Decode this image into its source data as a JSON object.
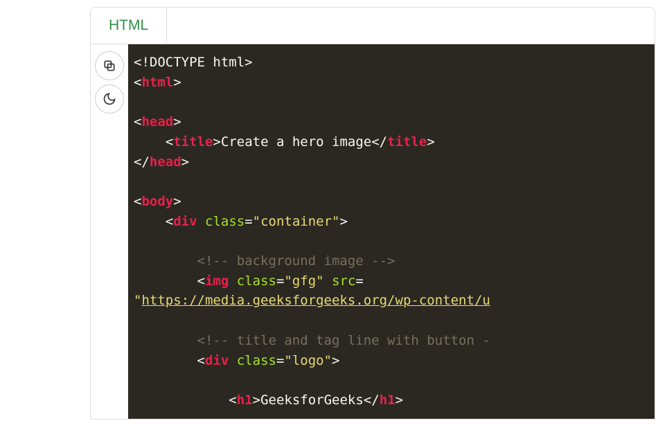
{
  "tab": {
    "label": "HTML"
  },
  "toolbar": {
    "copy": "Copy",
    "theme": "Toggle theme"
  },
  "code": {
    "l1_open": "<!DOCTYPE html>",
    "l2_lt": "<",
    "l2_tag": "html",
    "l2_gt": ">",
    "l3": "",
    "l4_lt": "<",
    "l4_tag": "head",
    "l4_gt": ">",
    "l5_ind": "    ",
    "l5_lt": "<",
    "l5_tag": "title",
    "l5_gt": ">",
    "l5_txt": "Create a hero image",
    "l5_lt2": "</",
    "l5_tag2": "title",
    "l5_gt2": ">",
    "l6_lt": "</",
    "l6_tag": "head",
    "l6_gt": ">",
    "l7": "",
    "l8_lt": "<",
    "l8_tag": "body",
    "l8_gt": ">",
    "l9_ind": "    ",
    "l9_lt": "<",
    "l9_tag": "div",
    "l9_sp": " ",
    "l9_attr": "class",
    "l9_eq": "=",
    "l9_str": "\"container\"",
    "l9_gt": ">",
    "l10": "",
    "l11_ind": "        ",
    "l11_c": "<!-- background image -->",
    "l12_ind": "        ",
    "l12_lt": "<",
    "l12_tag": "img",
    "l12_sp": " ",
    "l12_a1": "class",
    "l12_eq1": "=",
    "l12_s1": "\"gfg\"",
    "l12_sp2": " ",
    "l12_a2": "src",
    "l12_eq2": "=",
    "l13_q": "\"",
    "l13_url": "https://media.geeksforgeeks.org/wp-content/u",
    "l14": "",
    "l15_ind": "        ",
    "l15_c": "<!-- title and tag line with button -",
    "l16_ind": "        ",
    "l16_lt": "<",
    "l16_tag": "div",
    "l16_sp": " ",
    "l16_attr": "class",
    "l16_eq": "=",
    "l16_str": "\"logo\"",
    "l16_gt": ">",
    "l17": "",
    "l18_ind": "            ",
    "l18_lt": "<",
    "l18_tag": "h1",
    "l18_gt": ">",
    "l18_txt": "GeeksforGeeks",
    "l18_lt2": "</",
    "l18_tag2": "h1",
    "l18_gt2": ">"
  }
}
